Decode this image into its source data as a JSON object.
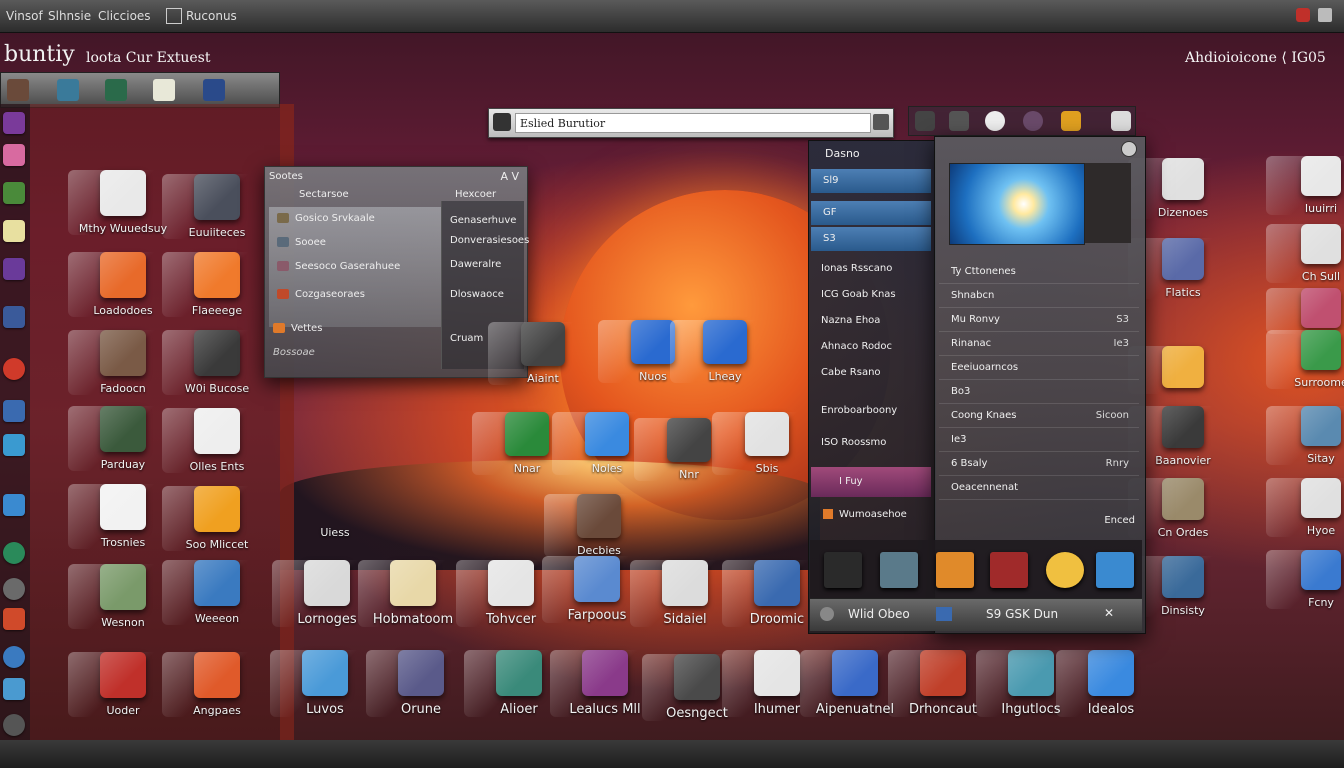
{
  "topbar": {
    "menu_1": "Vinsof",
    "menu_2": "Slhnsie",
    "menu_3": "Cliccioes",
    "menu_4": "Ruconus"
  },
  "brand": {
    "title": "buntiy",
    "sub": "loota  Cur  Extuest"
  },
  "system_label": "Ahdioioicone  ⟨  IG05",
  "search": {
    "value": "Eslied Burutior"
  },
  "file_window": {
    "title": "Sootes",
    "close": "A V",
    "header_left": "Sectarsoe",
    "header_right": "Hexcoer",
    "rows": [
      "Gosico  Srvkaale",
      "Sooee",
      "Seesoco Gaserahuee",
      "Cozgaseoraes",
      "Vettes"
    ],
    "right_rows": [
      "Genaserhuve",
      "Donverasiesoes",
      "Daweralre",
      "Dloswaoce",
      "Cruam"
    ],
    "footer": "Bossoae"
  },
  "left_apps": [
    {
      "label": "Mthy Wuuedsuy",
      "color": "#e9e9e9"
    },
    {
      "label": "Euuiiteces",
      "color": "#4a4f5c"
    },
    {
      "label": "Loadodoes",
      "color": "#e86a2a"
    },
    {
      "label": "Flaeeege",
      "color": "#f07a2c"
    },
    {
      "label": "Fadoocn",
      "color": "#7a5a46"
    },
    {
      "label": "W0i Bucose",
      "color": "#3a3a3a"
    },
    {
      "label": "Parduay",
      "color": "#3b5a3c"
    },
    {
      "label": "Olles Ents",
      "color": "#eeeeee"
    },
    {
      "label": "Trosnies",
      "color": "#f2f2f2"
    },
    {
      "label": "Soo Mliccet",
      "color": "#f0a020"
    },
    {
      "label": "Wesnon",
      "color": "#7a9a6a"
    },
    {
      "label": "Weeeon",
      "color": "#3a7ac0"
    },
    {
      "label": "Uoder",
      "color": "#c0302a"
    },
    {
      "label": "Angpaes",
      "color": "#e05a2a"
    }
  ],
  "center_apps": [
    {
      "label": "Aiaint",
      "color": "#444444"
    },
    {
      "label": "Nuos",
      "color": "#2a6ad0"
    },
    {
      "label": "Lheay",
      "color": "#2a6ad0"
    },
    {
      "label": "Nnar",
      "color": "#2a8a3a"
    },
    {
      "label": "Noles",
      "color": "#3a8ae0"
    },
    {
      "label": "Nnr",
      "color": "#444444"
    },
    {
      "label": "Sbis",
      "color": "#e2e2e2"
    },
    {
      "label": "Decbies",
      "color": "#6a4a3a"
    }
  ],
  "mid_label": "Uiess",
  "row_apps": [
    {
      "label": "Lornoges",
      "color": "#d9d9d9"
    },
    {
      "label": "Hobmatoom",
      "color": "#e8d8a8"
    },
    {
      "label": "Tohvcer",
      "color": "#e5e5e5"
    },
    {
      "label": "Farpoous",
      "color": "#5a8ad0"
    },
    {
      "label": "Sidaiel",
      "color": "#dcdcdc"
    },
    {
      "label": "Droomic",
      "color": "#3a6ab0"
    }
  ],
  "bottom_apps": [
    {
      "label": "Luvos",
      "color": "#4a9ad8"
    },
    {
      "label": "Orune",
      "color": "#5a5a8a"
    },
    {
      "label": "Alioer",
      "color": "#3a8a7a"
    },
    {
      "label": "Lealucs Mll",
      "color": "#8a3a8a"
    },
    {
      "label": "Oesngect",
      "color": "#4a4a4a"
    },
    {
      "label": "Ihumer",
      "color": "#e5e5e5"
    },
    {
      "label": "Aipenuatnel",
      "color": "#3a6ac8"
    },
    {
      "label": "Drhoncaut",
      "color": "#c0402a"
    },
    {
      "label": "Ihgutlocs",
      "color": "#4a9ab0"
    },
    {
      "label": "Idealos",
      "color": "#3a8ae0"
    }
  ],
  "right_edge_apps": [
    {
      "label": "Dizenoes",
      "color": "#e0e0e0"
    },
    {
      "label": "Flatics",
      "color": "#5a6aa8"
    },
    {
      "label": "",
      "color": "#f0b040"
    },
    {
      "label": "Baanovier",
      "color": "#3a3a3a"
    },
    {
      "label": "Cn Ordes",
      "color": "#9a8a6a"
    },
    {
      "label": "Dinsisty",
      "color": "#3a6a9a"
    }
  ],
  "far_right_apps": [
    {
      "label": "Iuuirri",
      "color": "#e8e8e8"
    },
    {
      "label": "Ch Sull",
      "color": "#e0e0e0"
    },
    {
      "label": "",
      "color": "#c05070"
    },
    {
      "label": "Surroome",
      "color": "#3a9a4a"
    },
    {
      "label": "Sitay",
      "color": "#5a8ab0"
    },
    {
      "label": "Hyoe",
      "color": "#e0e0e0"
    },
    {
      "label": "Fcny",
      "color": "#3a7ad0"
    }
  ],
  "right_panel": {
    "title": "Dasno",
    "rows": [
      "Sl9",
      "GF",
      "S3",
      "Ionas Rsscano",
      "ICG Goab Knas",
      "Nazna Ehoa",
      "Ahnaco Rodoc",
      "Cabe Rsano",
      "Enroboarboony",
      "ISO Roossmo",
      "I Fuy",
      "Wumoasehoe"
    ]
  },
  "detail": {
    "rows": [
      {
        "a": "Ty Cttonenes",
        "b": ""
      },
      {
        "a": "Shnabcn",
        "b": ""
      },
      {
        "a": "Mu Ronvy",
        "b": "S3"
      },
      {
        "a": "Rinanac",
        "b": "Ie3"
      },
      {
        "a": "Eeeiuoarncos",
        "b": ""
      },
      {
        "a": "Bo3",
        "b": ""
      },
      {
        "a": "Coong Knaes",
        "b": "Sicoon"
      },
      {
        "a": "Ie3",
        "b": ""
      },
      {
        "a": "6  Bsaly",
        "b": "Rnry"
      },
      {
        "a": "Oeacennenat",
        "b": ""
      }
    ],
    "footer_right": "Enced"
  },
  "statusbar": {
    "left": "Wlid Obeo",
    "right": "S9  GSK Dun"
  }
}
